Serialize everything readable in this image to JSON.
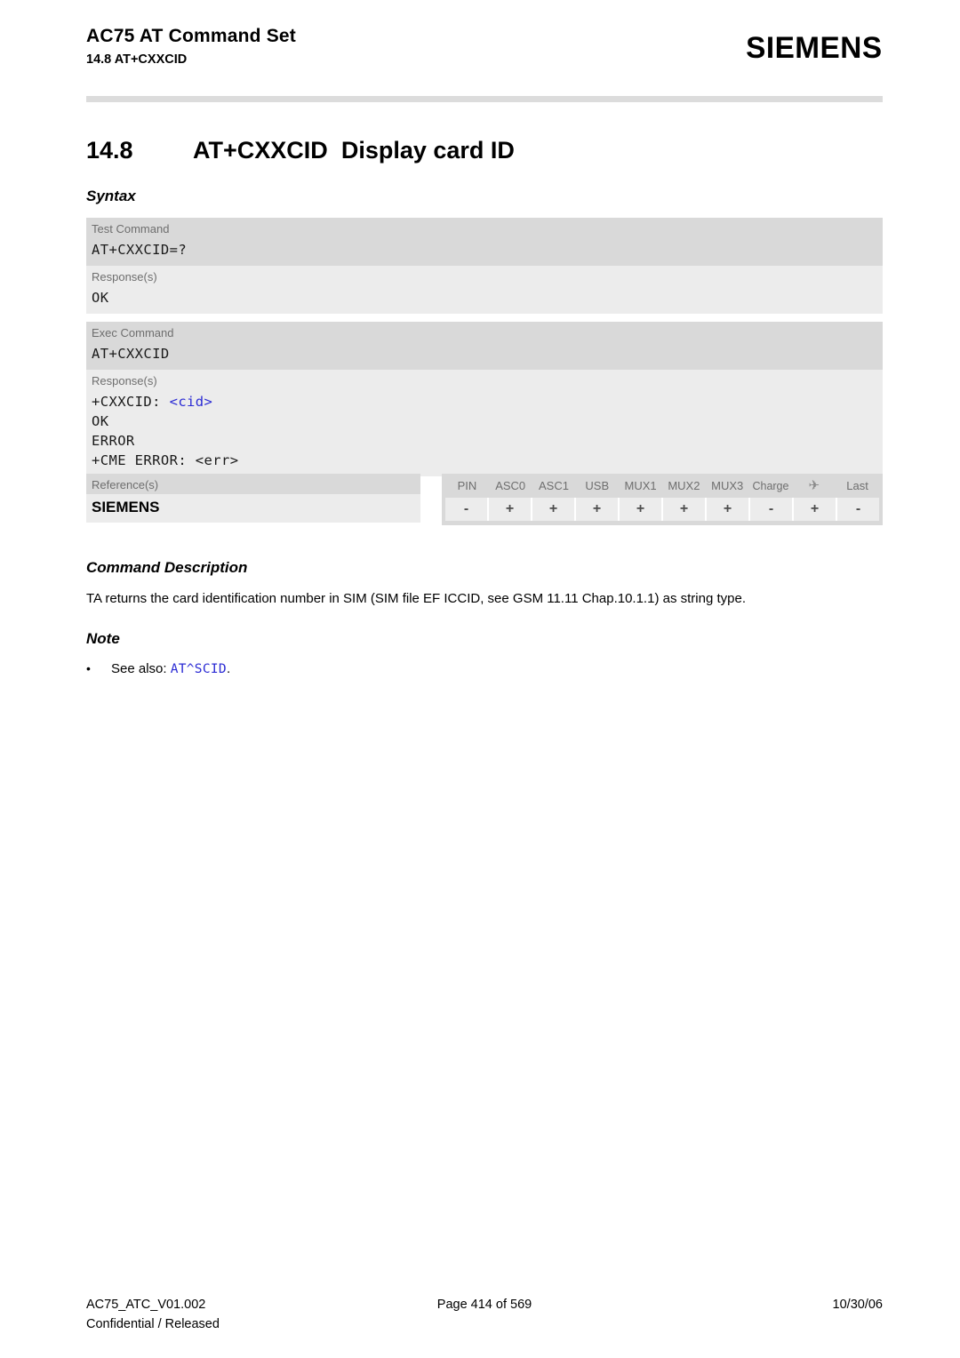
{
  "header": {
    "doc_title": "AC75 AT Command Set",
    "section_ref": "14.8 AT+CXXCID",
    "brand": "SIEMENS"
  },
  "section": {
    "number": "14.8",
    "command": "AT+CXXCID",
    "description": "Display card ID"
  },
  "headings": {
    "syntax": "Syntax",
    "command_description": "Command Description",
    "note": "Note"
  },
  "syntax_blocks": [
    {
      "command_label": "Test Command",
      "command_lines": [
        "AT+CXXCID=?"
      ],
      "response_label": "Response(s)",
      "response_lines": [
        {
          "text": "OK",
          "param": ""
        }
      ]
    },
    {
      "command_label": "Exec Command",
      "command_lines": [
        "AT+CXXCID"
      ],
      "response_label": "Response(s)",
      "response_lines": [
        {
          "text": "+CXXCID: ",
          "param": "<cid>"
        },
        {
          "text": "OK",
          "param": ""
        },
        {
          "text": "ERROR",
          "param": ""
        },
        {
          "text": "+CME ERROR: <err>",
          "param": ""
        }
      ]
    }
  ],
  "references": {
    "label": "Reference(s)",
    "value": "SIEMENS"
  },
  "capability_matrix": {
    "columns": [
      "PIN",
      "ASC0",
      "ASC1",
      "USB",
      "MUX1",
      "MUX2",
      "MUX3",
      "Charge",
      "airplane-icon",
      "Last"
    ],
    "airplane_glyph": "✈",
    "values": [
      "-",
      "+",
      "+",
      "+",
      "+",
      "+",
      "+",
      "-",
      "+",
      "-"
    ]
  },
  "command_description": {
    "text": "TA returns the card identification number in SIM (SIM file EF ICCID, see GSM 11.11 Chap.10.1.1) as string type."
  },
  "note": {
    "bullet": "•",
    "prefix": "See also: ",
    "link": "AT^SCID",
    "suffix": "."
  },
  "footer": {
    "doc_id": "AC75_ATC_V01.002",
    "page": "Page 414 of 569",
    "date": "10/30/06",
    "classification": "Confidential / Released"
  },
  "colors": {
    "band_dark": "#d9d9d9",
    "band_light": "#ececec",
    "label_gray": "#6e6e6e",
    "link_blue": "#2b2bd4"
  }
}
